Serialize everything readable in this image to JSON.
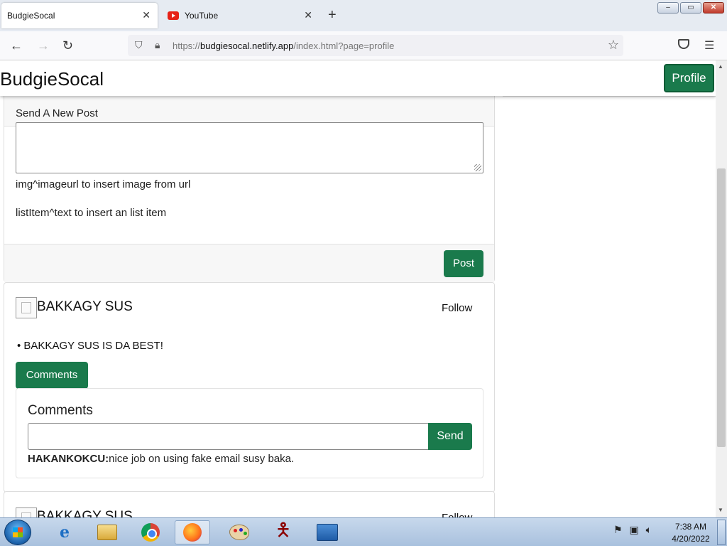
{
  "browser": {
    "tabs": [
      {
        "title": "BudgieSocal",
        "active": true
      },
      {
        "title": "YouTube",
        "active": false
      }
    ],
    "new_tab_label": "+",
    "close_glyph": "✕",
    "url_prefix": "https://",
    "url_host": "budgiesocal.netlify.app",
    "url_path": "/index.html?page=profile",
    "window_buttons": {
      "minimize": "–",
      "maximize": "▭",
      "close": "✕"
    }
  },
  "site": {
    "brand": "BudgieSocal",
    "profile_button": "Profile"
  },
  "composer": {
    "title": "Send A New Post",
    "textarea_value": "",
    "hint_image": "img^imageurl to insert image from url",
    "hint_list": "listItem^text to insert an list item",
    "post_button": "Post"
  },
  "feed": [
    {
      "username": "BAKKAGY SUS",
      "follow_label": "Follow",
      "list_items": [
        "BAKKAGY SUS IS DA BEST!"
      ],
      "comments_button": "Comments",
      "comments_title": "Comments",
      "comment_input_value": "",
      "send_button": "Send",
      "comments": [
        {
          "author": "HAKANKOKCU:",
          "text": "nice job on using fake email susy baka."
        }
      ]
    },
    {
      "username": "BAKKAGY SUS",
      "follow_label": "Follow"
    }
  ],
  "taskbar": {
    "apps": [
      "internet-explorer",
      "file-explorer",
      "chrome",
      "firefox",
      "paint",
      "stick-figure-app",
      "control-panel"
    ],
    "active_app": "firefox",
    "tray_icons": [
      "network-error-icon",
      "network-icon",
      "volume-icon"
    ],
    "time": "7:38 AM",
    "date": "4/20/2022"
  },
  "colors": {
    "accent_green": "#1a7a4c",
    "tab_strip": "#e6ebf2",
    "taskbar": "#b6cbe4"
  }
}
